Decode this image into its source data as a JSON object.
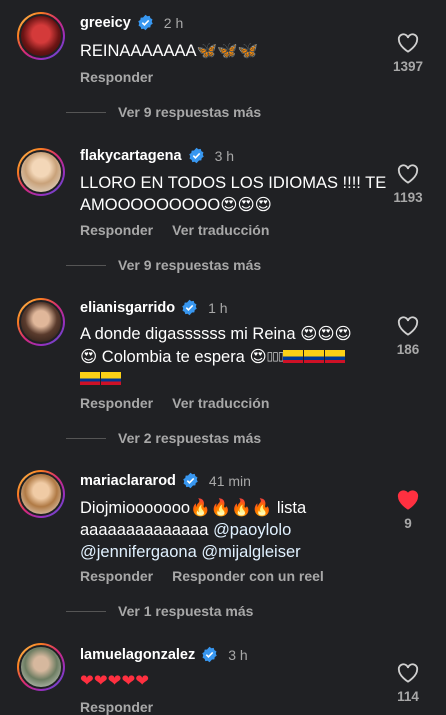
{
  "actions": {
    "reply": "Responder",
    "translate": "Ver traducción",
    "reply_reel": "Responder con un reel"
  },
  "comments": [
    {
      "user": "greeicy",
      "time": "2 h",
      "text": "REINAAAAAAA🦋🦋🦋",
      "likes": "1397",
      "liked": false,
      "replies": "Ver 9 respuestas más"
    },
    {
      "user": "flakycartagena",
      "time": "3 h",
      "text": "LLORO EN TODOS LOS IDIOMAS !!!! TE AMOOOOOOOOO😍😍😍",
      "likes": "1193",
      "liked": false,
      "replies": "Ver 9 respuestas más"
    },
    {
      "user": "elianisgarrido",
      "time": "1 h",
      "text_line1": "A donde digassssss mi Reina 😍😍😍",
      "text_line2": "😍 Colombia te espera 😍",
      "text_boxes": "▯▯▯",
      "likes": "186",
      "liked": false,
      "replies": "Ver 2 respuestas más"
    },
    {
      "user": "mariaclararod",
      "time": "41 min",
      "text_part1": "Diojmiooooooo🔥🔥🔥🔥 lista aaaaaaaaaaaaaa ",
      "mention1": "@paoylolo",
      "mention2": "@jennifergaona",
      "mention3": "@mijalgleiser",
      "likes": "9",
      "liked": true,
      "replies": "Ver 1 respuesta más"
    },
    {
      "user": "lamuelagonzalez",
      "time": "3 h",
      "text": "❤❤❤❤❤",
      "likes": "114",
      "liked": false
    }
  ],
  "colors": {
    "background": "#202124",
    "muted": "#a8a8a8",
    "verified": "#3897f0",
    "like_red": "#ff3040"
  }
}
